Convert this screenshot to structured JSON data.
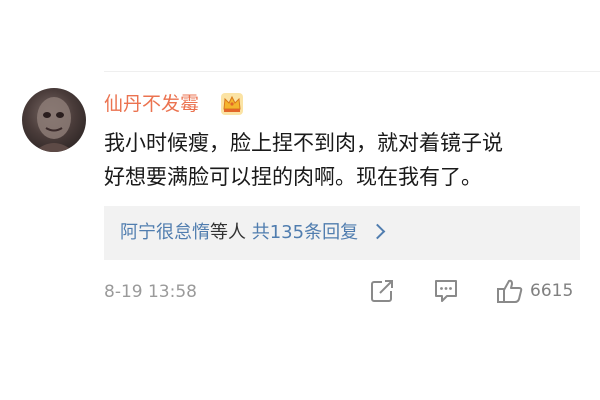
{
  "comment": {
    "username": "仙丹不发霉",
    "text_lines": [
      "我小时候瘦，脸上捏不到肉，就对着镜子说",
      "好想要满脸可以捏的肉啊。现在我有了。"
    ],
    "replies": {
      "user": "阿宁很怠惰",
      "suffix": "等人",
      "count_text": "共135条回复"
    },
    "timestamp": "8-19 13:58",
    "like_count": "6615"
  },
  "icons": {
    "badge": "crown-badge-icon",
    "share": "share-icon",
    "comment": "comment-icon",
    "like": "thumbs-up-icon"
  },
  "colors": {
    "username": "#eb7350",
    "link": "#507daf",
    "reply_bg": "#f2f2f2",
    "meta": "#9a9a9a"
  }
}
